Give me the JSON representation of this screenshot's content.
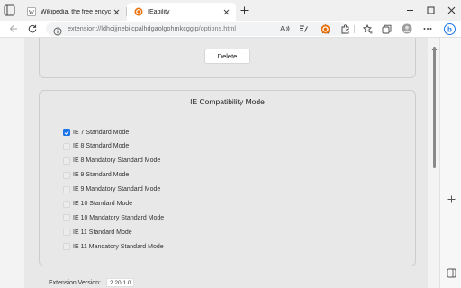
{
  "browser": {
    "tabs": [
      {
        "title": "Wikipedia, the free encyclopedia",
        "active": false,
        "favicon": "wikipedia-w-icon"
      },
      {
        "title": "IEability",
        "active": true,
        "favicon": "ieability-icon"
      }
    ],
    "url": {
      "scheme": "extension://",
      "host": "ldhcijjnebiicpalhdgaolgohmkcggip",
      "path": "/options.html"
    },
    "accent_color": "#1a73e8"
  },
  "options": {
    "delete_label": "Delete",
    "ie_mode_title": "IE Compatibility Mode",
    "modes": [
      {
        "label": "IE 7 Standard Mode",
        "checked": true
      },
      {
        "label": "IE 8 Standard Mode",
        "checked": false
      },
      {
        "label": "IE 8 Mandatory Standard Mode",
        "checked": false
      },
      {
        "label": "IE 9 Standard Mode",
        "checked": false
      },
      {
        "label": "IE 9 Mandatory Standard Mode",
        "checked": false
      },
      {
        "label": "IE 10 Standard Mode",
        "checked": false
      },
      {
        "label": "IE 10 Mandatory Standard Mode",
        "checked": false
      },
      {
        "label": "IE 11 Standard Mode",
        "checked": false
      },
      {
        "label": "IE 11 Mandatory Standard Mode",
        "checked": false
      }
    ],
    "version_label": "Extension Version:",
    "version_value": "2.20.1.0"
  }
}
